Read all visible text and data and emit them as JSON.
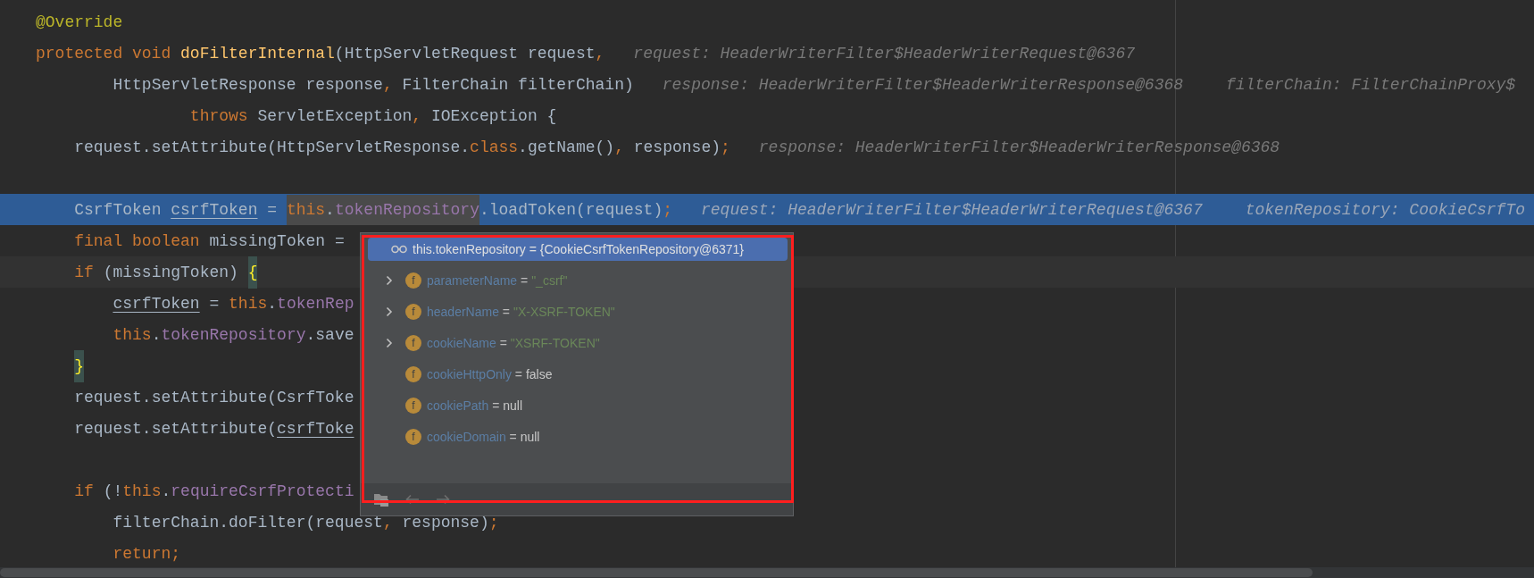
{
  "editor": {
    "lines": [
      {
        "selected": false,
        "caret": false,
        "tokens": [
          {
            "kind": "annotation",
            "text": "@Override"
          }
        ]
      },
      {
        "selected": false,
        "caret": false,
        "tokens": [
          {
            "kind": "keyword",
            "text": "protected void "
          },
          {
            "kind": "method",
            "text": "doFilterInternal"
          },
          {
            "kind": "plain",
            "text": "(HttpServletRequest request"
          },
          {
            "kind": "keyword",
            "text": ","
          }
        ],
        "hints": [
          "request: HeaderWriterFilter$HeaderWriterRequest@6367"
        ]
      },
      {
        "selected": false,
        "caret": false,
        "tokens": [
          {
            "kind": "plain",
            "text": "        HttpServletResponse response"
          },
          {
            "kind": "keyword",
            "text": ","
          },
          {
            "kind": "plain",
            "text": " FilterChain filterChain)"
          }
        ],
        "hints": [
          "response: HeaderWriterFilter$HeaderWriterResponse@6368",
          "filterChain: FilterChainProxy$"
        ]
      },
      {
        "selected": false,
        "caret": false,
        "tokens": [
          {
            "kind": "keyword",
            "text": "                throws"
          },
          {
            "kind": "plain",
            "text": " ServletException"
          },
          {
            "kind": "keyword",
            "text": ","
          },
          {
            "kind": "plain",
            "text": " IOException {"
          }
        ]
      },
      {
        "selected": false,
        "caret": false,
        "tokens": [
          {
            "kind": "plain",
            "text": "    request.setAttribute(HttpServletResponse."
          },
          {
            "kind": "keyword",
            "text": "class"
          },
          {
            "kind": "plain",
            "text": ".getName()"
          },
          {
            "kind": "keyword",
            "text": ","
          },
          {
            "kind": "plain",
            "text": " response)"
          },
          {
            "kind": "keyword",
            "text": ";"
          }
        ],
        "hints": [
          "response: HeaderWriterFilter$HeaderWriterResponse@6368"
        ]
      },
      {
        "selected": true,
        "caret": false,
        "gap_before": true,
        "tokens": [
          {
            "kind": "plain",
            "text": "    CsrfToken "
          },
          {
            "kind": "local",
            "text": "csrfToken"
          },
          {
            "kind": "plain",
            "text": " = "
          },
          {
            "kind": "keyword-marked",
            "text": "this"
          },
          {
            "kind": "plain-marked",
            "text": "."
          },
          {
            "kind": "field-marked",
            "text": "tokenRepository"
          },
          {
            "kind": "plain",
            "text": ".loadToken(request)"
          },
          {
            "kind": "keyword",
            "text": ";"
          }
        ],
        "hints": [
          "request: HeaderWriterFilter$HeaderWriterRequest@6367",
          "tokenRepository: CookieCsrfTo"
        ]
      },
      {
        "selected": false,
        "caret": false,
        "tokens": [
          {
            "kind": "keyword",
            "text": "    final boolean"
          },
          {
            "kind": "plain",
            "text": " missingToken ="
          }
        ]
      },
      {
        "selected": false,
        "caret": true,
        "tokens": [
          {
            "kind": "keyword",
            "text": "    if"
          },
          {
            "kind": "plain",
            "text": " (missingToken) "
          },
          {
            "kind": "brace",
            "text": "{"
          }
        ]
      },
      {
        "selected": false,
        "caret": false,
        "tokens": [
          {
            "kind": "local",
            "text": "        csrfToken"
          },
          {
            "kind": "plain",
            "text": " = "
          },
          {
            "kind": "keyword",
            "text": "this"
          },
          {
            "kind": "plain",
            "text": "."
          },
          {
            "kind": "field",
            "text": "tokenRep"
          }
        ]
      },
      {
        "selected": false,
        "caret": false,
        "tokens": [
          {
            "kind": "keyword",
            "text": "        this"
          },
          {
            "kind": "plain",
            "text": "."
          },
          {
            "kind": "field",
            "text": "tokenRepository"
          },
          {
            "kind": "plain",
            "text": ".save"
          }
        ]
      },
      {
        "selected": false,
        "caret": false,
        "tokens": [
          {
            "kind": "brace",
            "text": "    }"
          }
        ]
      },
      {
        "selected": false,
        "caret": false,
        "tokens": [
          {
            "kind": "plain",
            "text": "    request.setAttribute(CsrfToke"
          }
        ]
      },
      {
        "selected": false,
        "caret": false,
        "tokens": [
          {
            "kind": "plain",
            "text": "    request.setAttribute("
          },
          {
            "kind": "local",
            "text": "csrfToke"
          }
        ]
      },
      {
        "selected": false,
        "caret": false,
        "gap_before": true,
        "tokens": [
          {
            "kind": "keyword",
            "text": "    if"
          },
          {
            "kind": "plain",
            "text": " (!"
          },
          {
            "kind": "keyword",
            "text": "this"
          },
          {
            "kind": "plain",
            "text": "."
          },
          {
            "kind": "field",
            "text": "requireCsrfProtecti"
          }
        ]
      },
      {
        "selected": false,
        "caret": false,
        "tokens": [
          {
            "kind": "plain",
            "text": "        filterChain.doFilter(request"
          },
          {
            "kind": "keyword",
            "text": ","
          },
          {
            "kind": "plain",
            "text": " response)"
          },
          {
            "kind": "keyword",
            "text": ";"
          }
        ]
      },
      {
        "selected": false,
        "caret": false,
        "tokens": [
          {
            "kind": "keyword",
            "text": "        return;"
          }
        ]
      }
    ]
  },
  "popup": {
    "header": {
      "text": "this.tokenRepository = {CookieCsrfTokenRepository@6371}",
      "selected": true
    },
    "fields": [
      {
        "badge": "f",
        "name": "parameterName",
        "separator": "=",
        "value": "\"_csrf\"",
        "kind": "string",
        "expandable": true
      },
      {
        "badge": "f",
        "name": "headerName",
        "separator": "=",
        "value": "\"X-XSRF-TOKEN\"",
        "kind": "string",
        "expandable": true
      },
      {
        "badge": "f",
        "name": "cookieName",
        "separator": "=",
        "value": "\"XSRF-TOKEN\"",
        "kind": "string",
        "expandable": true
      },
      {
        "badge": "f",
        "name": "cookieHttpOnly",
        "separator": "=",
        "value": "false",
        "kind": "literal",
        "expandable": false
      },
      {
        "badge": "f",
        "name": "cookiePath",
        "separator": "=",
        "value": "null",
        "kind": "literal",
        "expandable": false
      },
      {
        "badge": "f",
        "name": "cookieDomain",
        "separator": "=",
        "value": "null",
        "kind": "literal",
        "expandable": false
      }
    ]
  }
}
